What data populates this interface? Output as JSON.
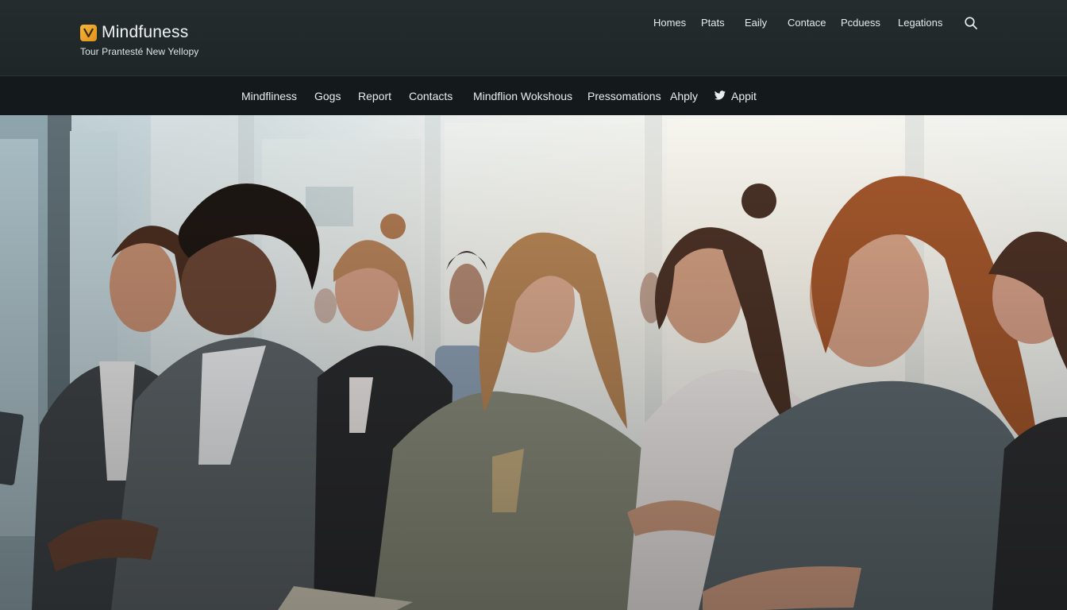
{
  "header": {
    "brand_name": "Mindfuness",
    "tagline": "Tour Prantesté New Yellopy",
    "logo_letter": "V",
    "logo_color": "#f0a52a",
    "nav": [
      "Homes",
      "Ptats",
      "Eaily",
      "Contace",
      "Pcduess",
      "Legations"
    ],
    "search_icon": "search-icon"
  },
  "subnav": {
    "items": [
      "Mindfliness",
      "Gogs",
      "Report",
      "Contacts",
      "Mindflion Wokshous",
      "Pressomations",
      "Ahply"
    ],
    "twitter_label": "Appit",
    "twitter_icon": "twitter-icon"
  },
  "hero": {
    "scene": "photo",
    "palette": {
      "window_light": "#e4ecef",
      "suit_gray": "#5a6268",
      "blazer_olive": "#8a8d7c",
      "hair_auburn": "#a5582c",
      "skin": "#c99478"
    }
  }
}
